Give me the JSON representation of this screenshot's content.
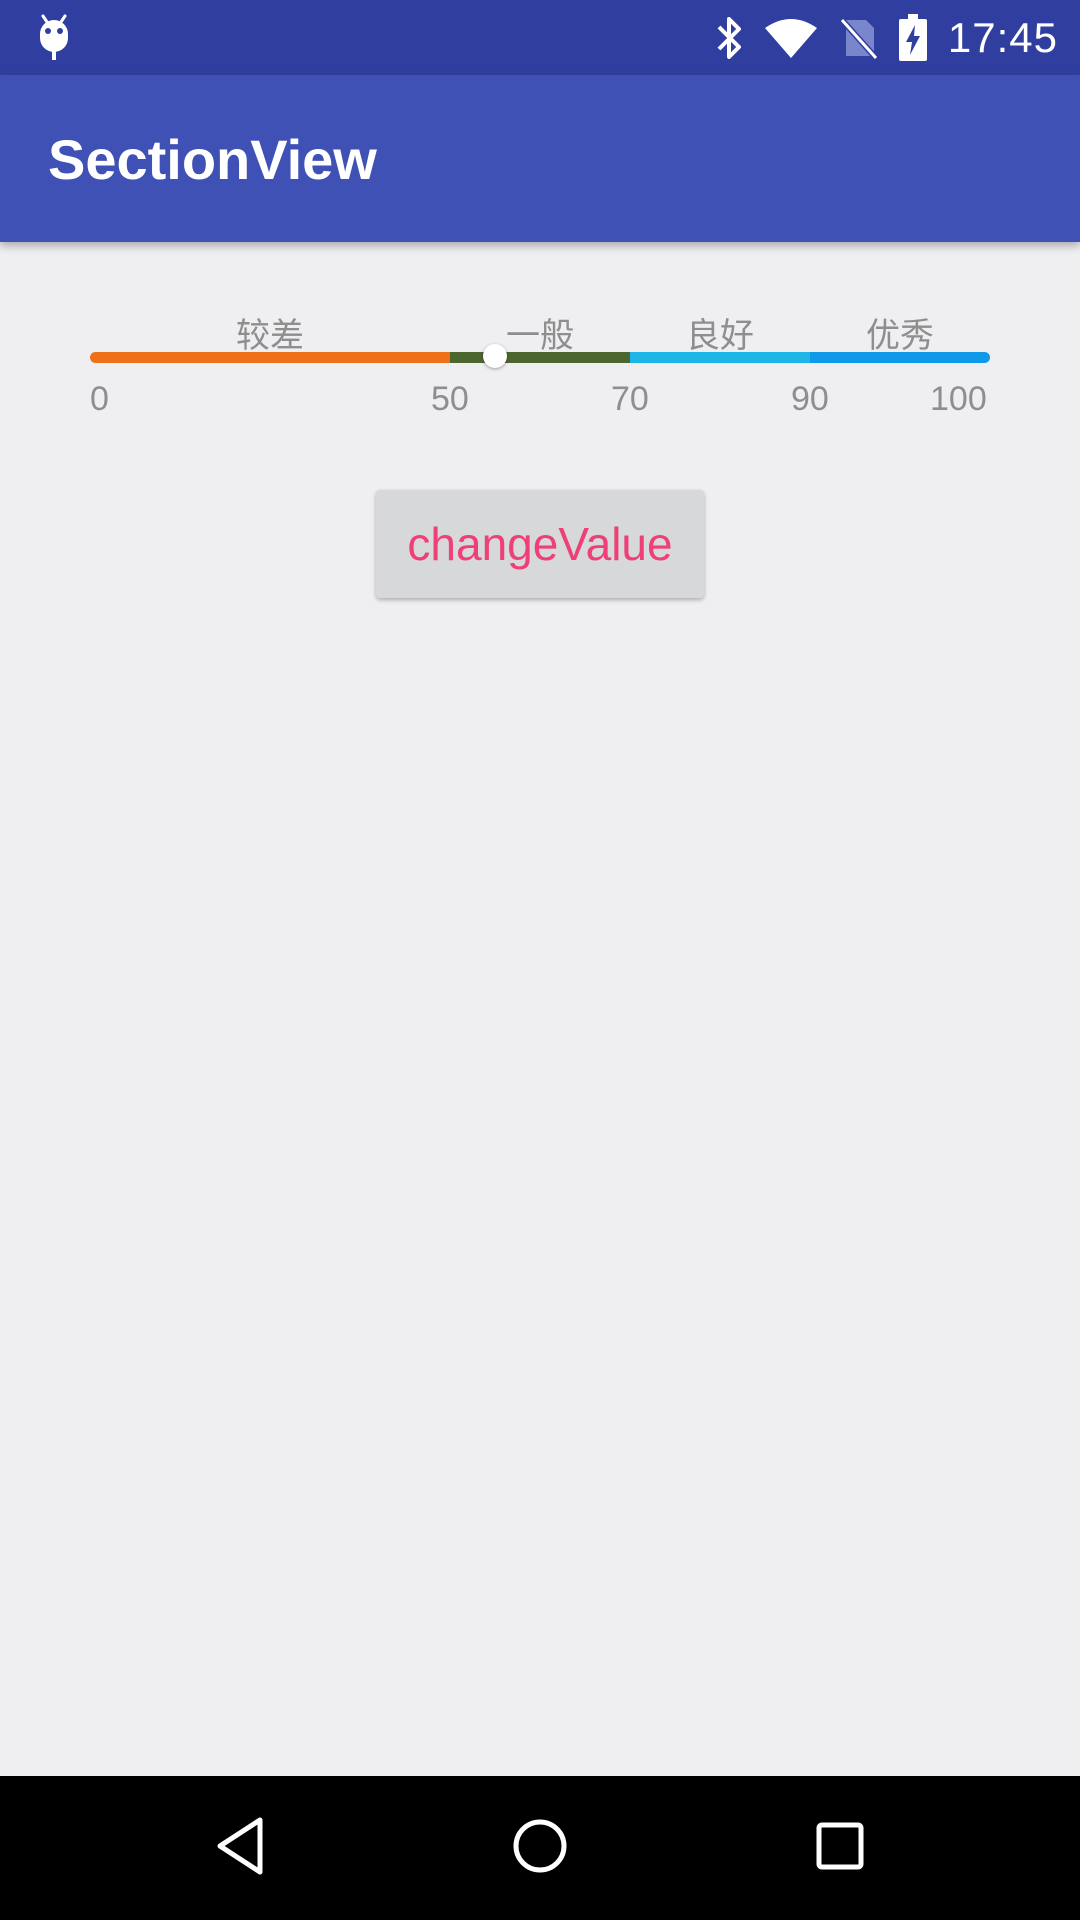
{
  "status_bar": {
    "time": "17:45",
    "icons": [
      "android-debug-icon",
      "bluetooth-icon",
      "wifi-icon",
      "no-sim-icon",
      "battery-charging-icon"
    ],
    "background": "#303f9f"
  },
  "app_bar": {
    "title": "SectionView",
    "background": "#3f51b5"
  },
  "section_view": {
    "sections": [
      {
        "label": "较差",
        "color": "#ee7119"
      },
      {
        "label": "一般",
        "color": "#4d652f"
      },
      {
        "label": "良好",
        "color": "#1db5e6"
      },
      {
        "label": "优秀",
        "color": "#0f99e8"
      }
    ],
    "ticks": [
      "0",
      "50",
      "70",
      "90",
      "100"
    ],
    "current_value": 55
  },
  "button": {
    "label": "changeValue",
    "text_color": "#ee3f77"
  },
  "nav_bar": {
    "buttons": [
      "back-icon",
      "home-icon",
      "recents-icon"
    ]
  }
}
